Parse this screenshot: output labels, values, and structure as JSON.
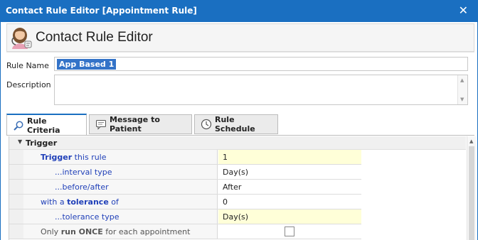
{
  "window": {
    "title": "Contact Rule Editor [Appointment Rule]",
    "close_glyph": "✕"
  },
  "header": {
    "icon": "user-avatar-icon",
    "title": "Contact Rule Editor"
  },
  "form": {
    "rule_name_label": "Rule Name",
    "rule_name_value": "App Based 1",
    "description_label": "Description",
    "description_value": ""
  },
  "tabs": [
    {
      "label": "Rule Criteria",
      "icon": "search-icon",
      "active": true
    },
    {
      "label": "Message to Patient",
      "icon": "message-icon",
      "active": false
    },
    {
      "label": "Rule Schedule",
      "icon": "clock-icon",
      "active": false
    }
  ],
  "grid": {
    "category": "Trigger",
    "rows": [
      {
        "parts": [
          {
            "t": "Trigger",
            "b": true
          },
          {
            "t": " this rule",
            "b": false
          }
        ],
        "value": "1"
      },
      {
        "parts": [
          {
            "t": "...interval type",
            "b": false
          }
        ],
        "value": "Day(s)"
      },
      {
        "parts": [
          {
            "t": "...before/after",
            "b": false
          }
        ],
        "value": "After"
      },
      {
        "parts": [
          {
            "t": "with a ",
            "b": false
          },
          {
            "t": "tolerance",
            "b": true
          },
          {
            "t": " of",
            "b": false
          }
        ],
        "value": "0"
      },
      {
        "parts": [
          {
            "t": "...tolerance type",
            "b": false
          }
        ],
        "value": "Day(s)"
      },
      {
        "parts": [
          {
            "t": "Only ",
            "b": false
          },
          {
            "t": "run ONCE",
            "b": true
          },
          {
            "t": " for each appointment",
            "b": false
          }
        ],
        "checked": false
      }
    ]
  },
  "colors": {
    "title_bar": "#1a6fc1",
    "selection": "#3373c8",
    "property_name_text": "#1f3fb8",
    "value_cell": "#ffffd8"
  }
}
